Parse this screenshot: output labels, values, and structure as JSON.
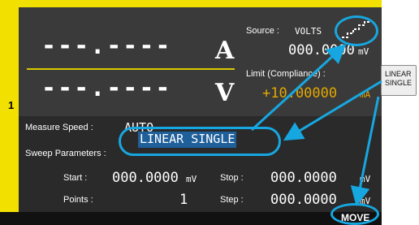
{
  "channel": "1",
  "readout": {
    "current_value": "---.----",
    "current_unit": "A",
    "voltage_value": "---.----",
    "voltage_unit": "V"
  },
  "source": {
    "label": "Source :",
    "mode": "VOLTS",
    "value": "000.0000",
    "unit": "mV",
    "icon": "staircase-sweep-icon"
  },
  "limit": {
    "label": "Limit (Compliance) :",
    "value": "+10.00000",
    "unit": "mA"
  },
  "measure_speed": {
    "label": "Measure Speed :",
    "value": "AUTO"
  },
  "sweep": {
    "label": "Sweep Parameters :",
    "value": "LINEAR SINGLE"
  },
  "start": {
    "label": "Start :",
    "value": "000.0000",
    "unit": "mV"
  },
  "stop": {
    "label": "Stop :",
    "value": "000.0000",
    "unit": "mV"
  },
  "points": {
    "label": "Points :",
    "value": "1"
  },
  "step": {
    "label": "Step :",
    "value": "000.0000",
    "unit": "mV"
  },
  "softkey": {
    "line1": "LINEAR",
    "line2": "SINGLE"
  },
  "status": {
    "move_label": "MOVE"
  },
  "colors": {
    "frame": "#f2e000",
    "callout": "#17a7e0",
    "limit_value": "#e3a800"
  }
}
